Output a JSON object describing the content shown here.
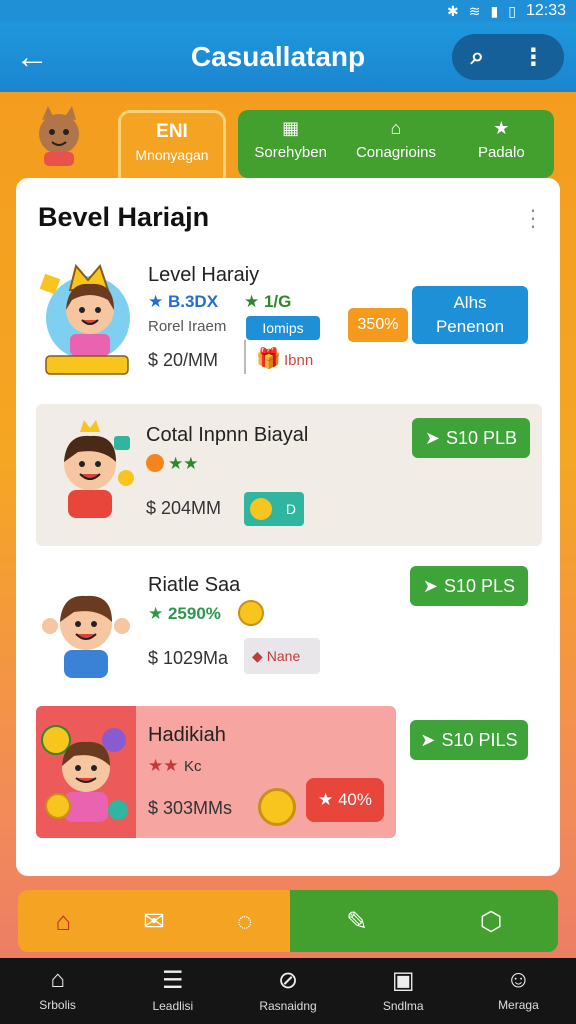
{
  "status_bar": {
    "time": "12:33",
    "icons": [
      "bluetooth-icon",
      "wifi-icon",
      "signal-icon",
      "battery-icon"
    ]
  },
  "app_bar": {
    "title": "Casuallatanp",
    "back_icon": "arrow-left-icon",
    "search_icon": "search-icon",
    "more_icon": "more-icon"
  },
  "tabs": {
    "active": {
      "line1": "ENI",
      "line2": "Mnonyagan"
    },
    "items": [
      {
        "icon": "grid-icon",
        "label": "Sorehyben"
      },
      {
        "icon": "home-icon",
        "label": "Conagrioins"
      },
      {
        "icon": "star-icon",
        "label": "Padalo"
      }
    ]
  },
  "card": {
    "title": "Bevel Hariajn",
    "rows": [
      {
        "name": "Level Haraiy",
        "stat1": "★ B.3DX",
        "stat2": "★ 1/G",
        "sub": "Rorel Iraem",
        "price": "$ 20/MM",
        "chip_blue": "Iomips",
        "chip_item": "Ibnn",
        "badge_orange": "350%",
        "button_line1": "Alhs",
        "button_line2": "Penenon"
      },
      {
        "name": "Cotal Inpnn Biayal",
        "stars": "★★",
        "price": "$ 204MM",
        "chip": "D",
        "button": "S10 PLB"
      },
      {
        "name": "Riatle Saa",
        "stat": "★ 2590%",
        "price": "$ 1029Ma",
        "chip": "Nane",
        "button": "S10 PLS"
      },
      {
        "name": "Hadikiah",
        "stars": "★★",
        "stat": "Kc",
        "price": "$ 303MMs",
        "badge": "★ 40%",
        "button": "S10 PILS"
      }
    ]
  },
  "toolbar": {
    "icons": [
      "home-icon",
      "envelope-icon",
      "chat-icon",
      "edit-icon",
      "box-icon"
    ]
  },
  "system_nav": [
    {
      "icon": "home-icon",
      "label": "Srbolis"
    },
    {
      "icon": "list-icon",
      "label": "Leadlisi"
    },
    {
      "icon": "compass-icon",
      "label": "Rasnaidng"
    },
    {
      "icon": "bag-icon",
      "label": "Sndlma"
    },
    {
      "icon": "user-icon",
      "label": "Meraga"
    }
  ],
  "colors": {
    "app_bar": "#1f97dc",
    "green": "#43a02f",
    "orange": "#f5a323",
    "red": "#e8453b"
  }
}
